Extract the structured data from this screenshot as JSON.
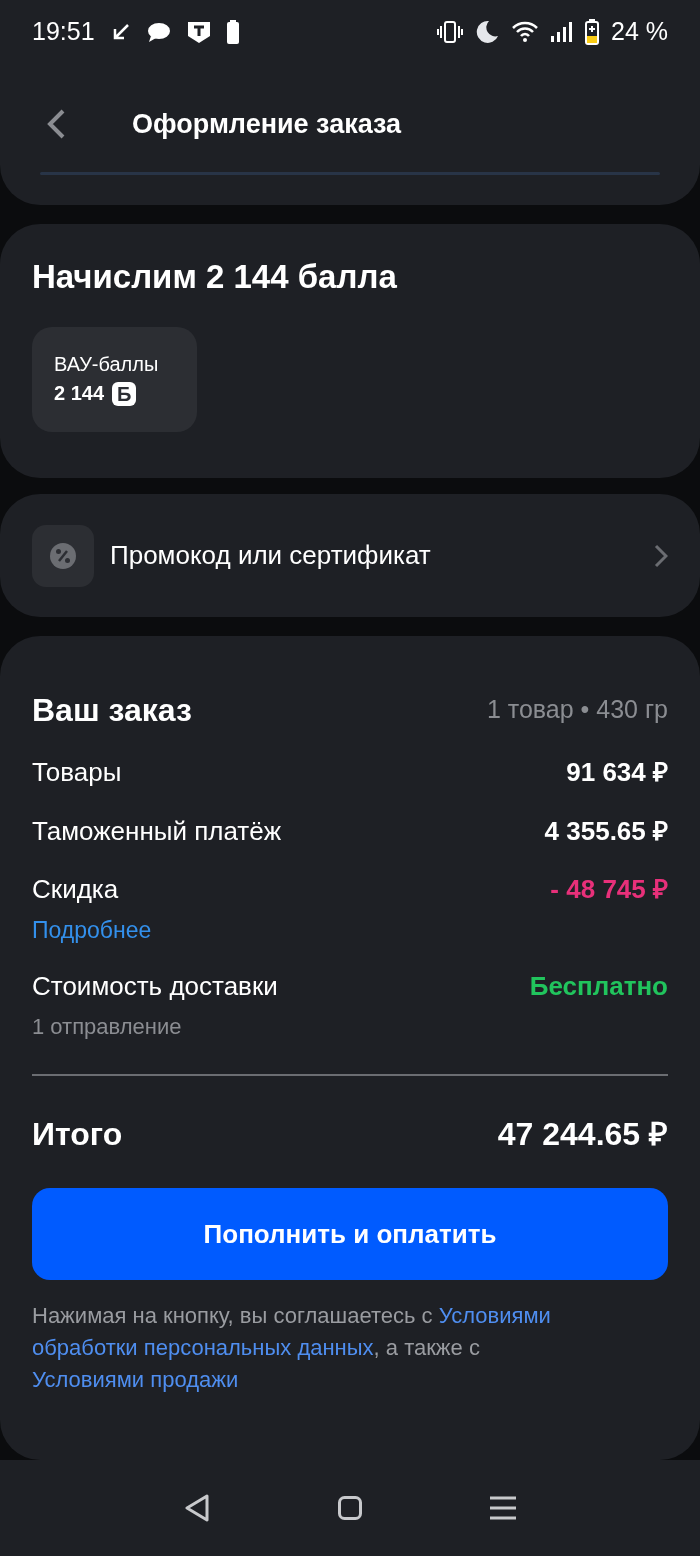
{
  "status_bar": {
    "time": "19:51",
    "battery": "24 %"
  },
  "header": {
    "title": "Оформление заказа"
  },
  "bonus": {
    "title": "Начислим 2 144 балла",
    "chip_label": "ВАУ-баллы",
    "chip_value": "2 144",
    "chip_badge": "Б"
  },
  "promo": {
    "label": "Промокод или сертификат"
  },
  "order": {
    "title": "Ваш заказ",
    "summary": "1 товар • 430 гр",
    "rows": [
      {
        "kind": "plain",
        "label": "Товары",
        "value": "91 634 ₽"
      },
      {
        "kind": "plain",
        "label": "Таможенный платёж",
        "value": "4 355.65 ₽"
      },
      {
        "kind": "discount",
        "label": "Скидка",
        "value": "- 48 745 ₽",
        "link": "Подробнее"
      },
      {
        "kind": "free",
        "label": "Стоимость доставки",
        "value": "Бесплатно",
        "note": "1 отправление"
      }
    ],
    "total_label": "Итого",
    "total_value": "47 244.65 ₽",
    "button": "Пополнить и оплатить",
    "legal": [
      {
        "kind": "text",
        "text": "Нажимая на кнопку, вы соглашаетесь с "
      },
      {
        "kind": "link",
        "text": "Условиями"
      },
      {
        "kind": "link",
        "text": "обработки персональных данных"
      },
      {
        "kind": "text",
        "text": ", а также с "
      },
      {
        "kind": "link",
        "text": "Условиями продажи"
      }
    ]
  }
}
